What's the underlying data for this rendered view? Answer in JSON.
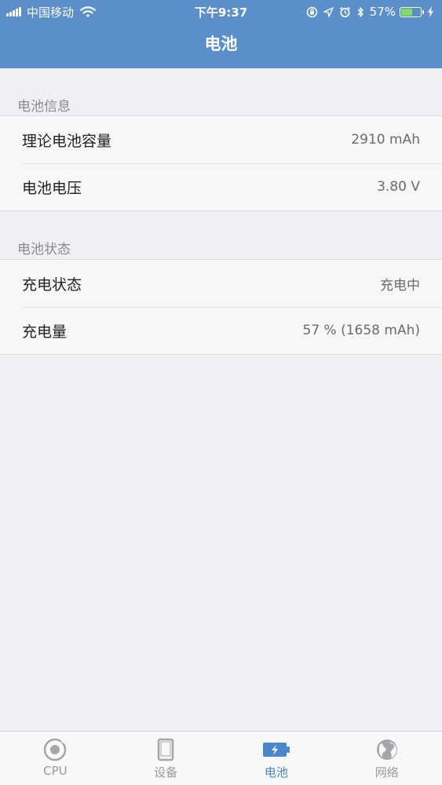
{
  "status_bar": {
    "carrier": "中国移动",
    "time": "下午9:37",
    "battery_percent": "57%",
    "battery_level": 0.57
  },
  "nav": {
    "title": "电池"
  },
  "sections": [
    {
      "header": "电池信息",
      "rows": [
        {
          "label": "理论电池容量",
          "value": "2910 mAh"
        },
        {
          "label": "电池电压",
          "value": "3.80 V"
        }
      ]
    },
    {
      "header": "电池状态",
      "rows": [
        {
          "label": "充电状态",
          "value": "充电中"
        },
        {
          "label": "充电量",
          "value": "57 % (1658 mAh)"
        }
      ]
    }
  ],
  "tabs": [
    {
      "label": "CPU",
      "icon": "cpu-icon",
      "active": false
    },
    {
      "label": "设备",
      "icon": "device-icon",
      "active": false
    },
    {
      "label": "电池",
      "icon": "battery-icon",
      "active": true
    },
    {
      "label": "网络",
      "icon": "globe-icon",
      "active": false
    }
  ],
  "colors": {
    "nav_background": "#5b8fc9",
    "active_tab": "#4a86c8",
    "inactive_tab": "#9b9b9f",
    "background": "#efeff4"
  }
}
